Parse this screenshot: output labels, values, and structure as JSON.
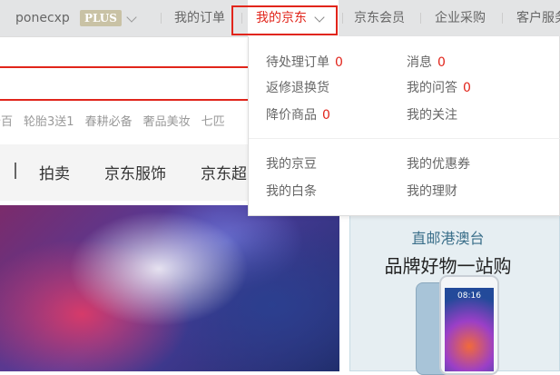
{
  "topbar": {
    "username": "ponecxp",
    "plus_badge": "PLUS",
    "my_orders": "我的订单",
    "my_jd": "我的京东",
    "jd_member": "京东会员",
    "enterprise": "企业采购",
    "customer_service": "客户服务"
  },
  "hot_links": [
    "秒百",
    "轮胎3送1",
    "春耕必备",
    "奢品美妆",
    "七匹"
  ],
  "nav": [
    "拍卖",
    "京东服饰",
    "京东超"
  ],
  "dropdown": {
    "pending_orders": {
      "label": "待处理订单",
      "count": "0"
    },
    "messages": {
      "label": "消息",
      "count": "0"
    },
    "returns": {
      "label": "返修退换货"
    },
    "my_qa": {
      "label": "我的问答",
      "count": "0"
    },
    "price_drop": {
      "label": "降价商品",
      "count": "0"
    },
    "my_follows": {
      "label": "我的关注"
    },
    "my_beans": {
      "label": "我的京豆"
    },
    "my_coupons": {
      "label": "我的优惠券"
    },
    "my_baitiao": {
      "label": "我的白条"
    },
    "my_finance": {
      "label": "我的理财"
    }
  },
  "banner_right": {
    "subtitle": "直邮港澳台",
    "title": "品牌好物一站购",
    "phone_time": "08:16"
  },
  "colors": {
    "accent": "#e1251b",
    "topbar_bg": "#e3e4e5"
  }
}
